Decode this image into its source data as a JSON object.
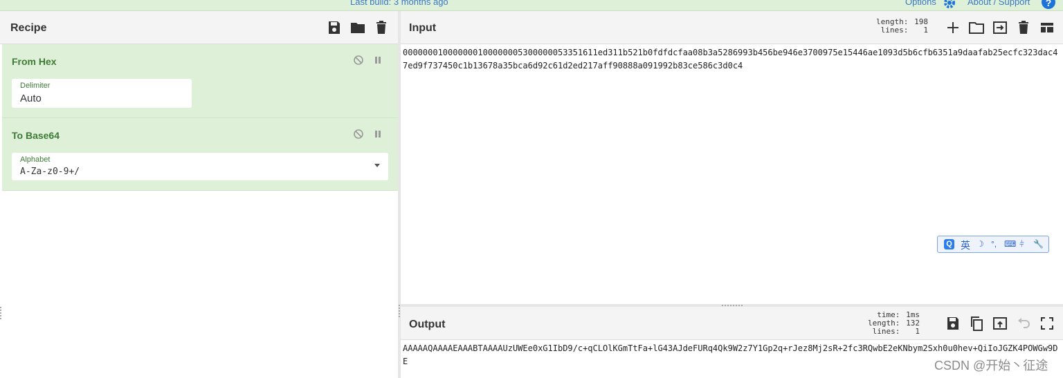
{
  "banner": {
    "last_build": "Last build: 3 months ago",
    "options": "Options",
    "about": "About / Support",
    "help_glyph": "?"
  },
  "recipe": {
    "title": "Recipe",
    "toolbar_icons": [
      "save-icon",
      "folder-icon",
      "trash-icon"
    ],
    "operations": [
      {
        "name": "From Hex",
        "arg_label": "Delimiter",
        "arg_value": "Auto"
      },
      {
        "name": "To Base64",
        "arg_label": "Alphabet",
        "arg_value": "A-Za-z0-9+/"
      }
    ]
  },
  "input": {
    "title": "Input",
    "stats": {
      "length_label": "length:",
      "length_value": "198",
      "lines_label": "lines:",
      "lines_value": "1"
    },
    "toolbar_icons": [
      "plus-icon",
      "open-folder-icon",
      "input-file-icon",
      "trash-icon",
      "layout-icon"
    ],
    "text": "000000010000000100000005300000053351611ed311b521b0fdfdcfaa08b3a5286993b456be946e3700975e15446ae1093d5b6cfb6351a9daafab25ecfc323dac47ed9f737450c1b13678a35bca6d92c61d2ed217aff90888a091992b83ce586c3d0c4"
  },
  "output": {
    "title": "Output",
    "stats": {
      "time_label": "time:",
      "time_value": "1ms",
      "length_label": "length:",
      "length_value": "132",
      "lines_label": "lines:",
      "lines_value": "1"
    },
    "toolbar_icons": [
      "save-icon",
      "copy-icon",
      "replace-input-icon",
      "undo-icon",
      "fullscreen-icon"
    ],
    "text": "AAAAAQAAAAEAAABTAAAAUzUWEe0xG1IbD9/c+qCLOlKGmTtFa+lG43AJdeFURq4Qk9W2z7Y1Gp2q+rJez8Mj2sR+2fc3RQwbE2eKNbym2Sxh0u0hev+QiIoJGZK4POWGw9DE"
  },
  "ime": {
    "logo": "Q",
    "language": "英",
    "symbols": [
      "☽",
      "°,",
      "⌨",
      "⫩",
      "🔧"
    ]
  },
  "watermark": "CSDN @开始丶征途",
  "colors": {
    "recipe_op_bg": "#dff0d8",
    "op_title": "#3c7a35",
    "link": "#3a78c4"
  }
}
